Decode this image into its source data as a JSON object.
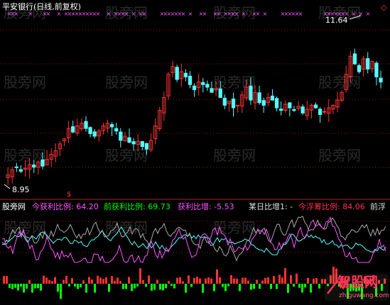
{
  "stock_title": "平安银行(日线,前复权)",
  "price_high_label": "11.64",
  "price_low_label": "8.95",
  "signal_glyph": "$",
  "corner_icon": "diamond-icon",
  "watermark": "股旁网",
  "indicator": {
    "name": "股旁网",
    "items": [
      {
        "label": "今获利比例: 64.20",
        "color": "#ff55ff"
      },
      {
        "label": "前获利比例: 69.73",
        "color": "#00ff00"
      },
      {
        "label": "获利比增: -5.53",
        "color": "#ff55ff"
      }
    ],
    "right_items": [
      {
        "label": "某日比增1: -",
        "color": "#dddddd"
      },
      {
        "label": "今浮筹比例: 84.06",
        "color": "#ff3355"
      },
      {
        "label": "前浮",
        "color": "#dddddd"
      }
    ]
  },
  "logo": {
    "text": "智股网",
    "url_text": "zhiguwang.com"
  },
  "colors": {
    "bg": "#000000",
    "up": "#ff3333",
    "down": "#55ffff",
    "grid": "#8b1a1a",
    "cross_marker": "#ff55ff",
    "profit_line": "#ff55ff",
    "prev_profit_line": "#aaaaaa",
    "float_line": "#55ffff",
    "bar_up": "#ff3333",
    "bar_down": "#00ff00"
  },
  "chart_data": {
    "type": "candlestick",
    "price_range": [
      8.6,
      11.9
    ],
    "series_close": [
      8.95,
      9.05,
      9.1,
      9.02,
      9.08,
      9.15,
      9.1,
      9.2,
      9.12,
      9.25,
      9.35,
      9.42,
      9.55,
      9.65,
      9.85,
      9.78,
      9.9,
      9.95,
      9.85,
      9.75,
      9.7,
      9.8,
      9.9,
      9.95,
      9.88,
      9.8,
      9.62,
      9.7,
      9.58,
      9.55,
      9.6,
      9.5,
      9.45,
      9.62,
      9.9,
      10.2,
      10.45,
      10.9,
      11.05,
      10.8,
      10.95,
      10.85,
      10.7,
      10.6,
      10.75,
      10.7,
      10.65,
      10.55,
      10.62,
      10.45,
      10.3,
      10.38,
      10.25,
      10.3,
      10.5,
      10.65,
      10.4,
      10.55,
      10.35,
      10.3,
      10.45,
      10.4,
      10.25,
      10.2,
      10.32,
      10.25,
      10.2,
      10.28,
      10.15,
      10.22,
      10.3,
      10.25,
      10.12,
      10.18,
      10.25,
      10.3,
      10.4,
      10.55,
      10.9,
      11.25,
      11.1,
      10.95,
      11.2,
      11.0,
      11.15,
      10.85,
      10.75
    ]
  }
}
